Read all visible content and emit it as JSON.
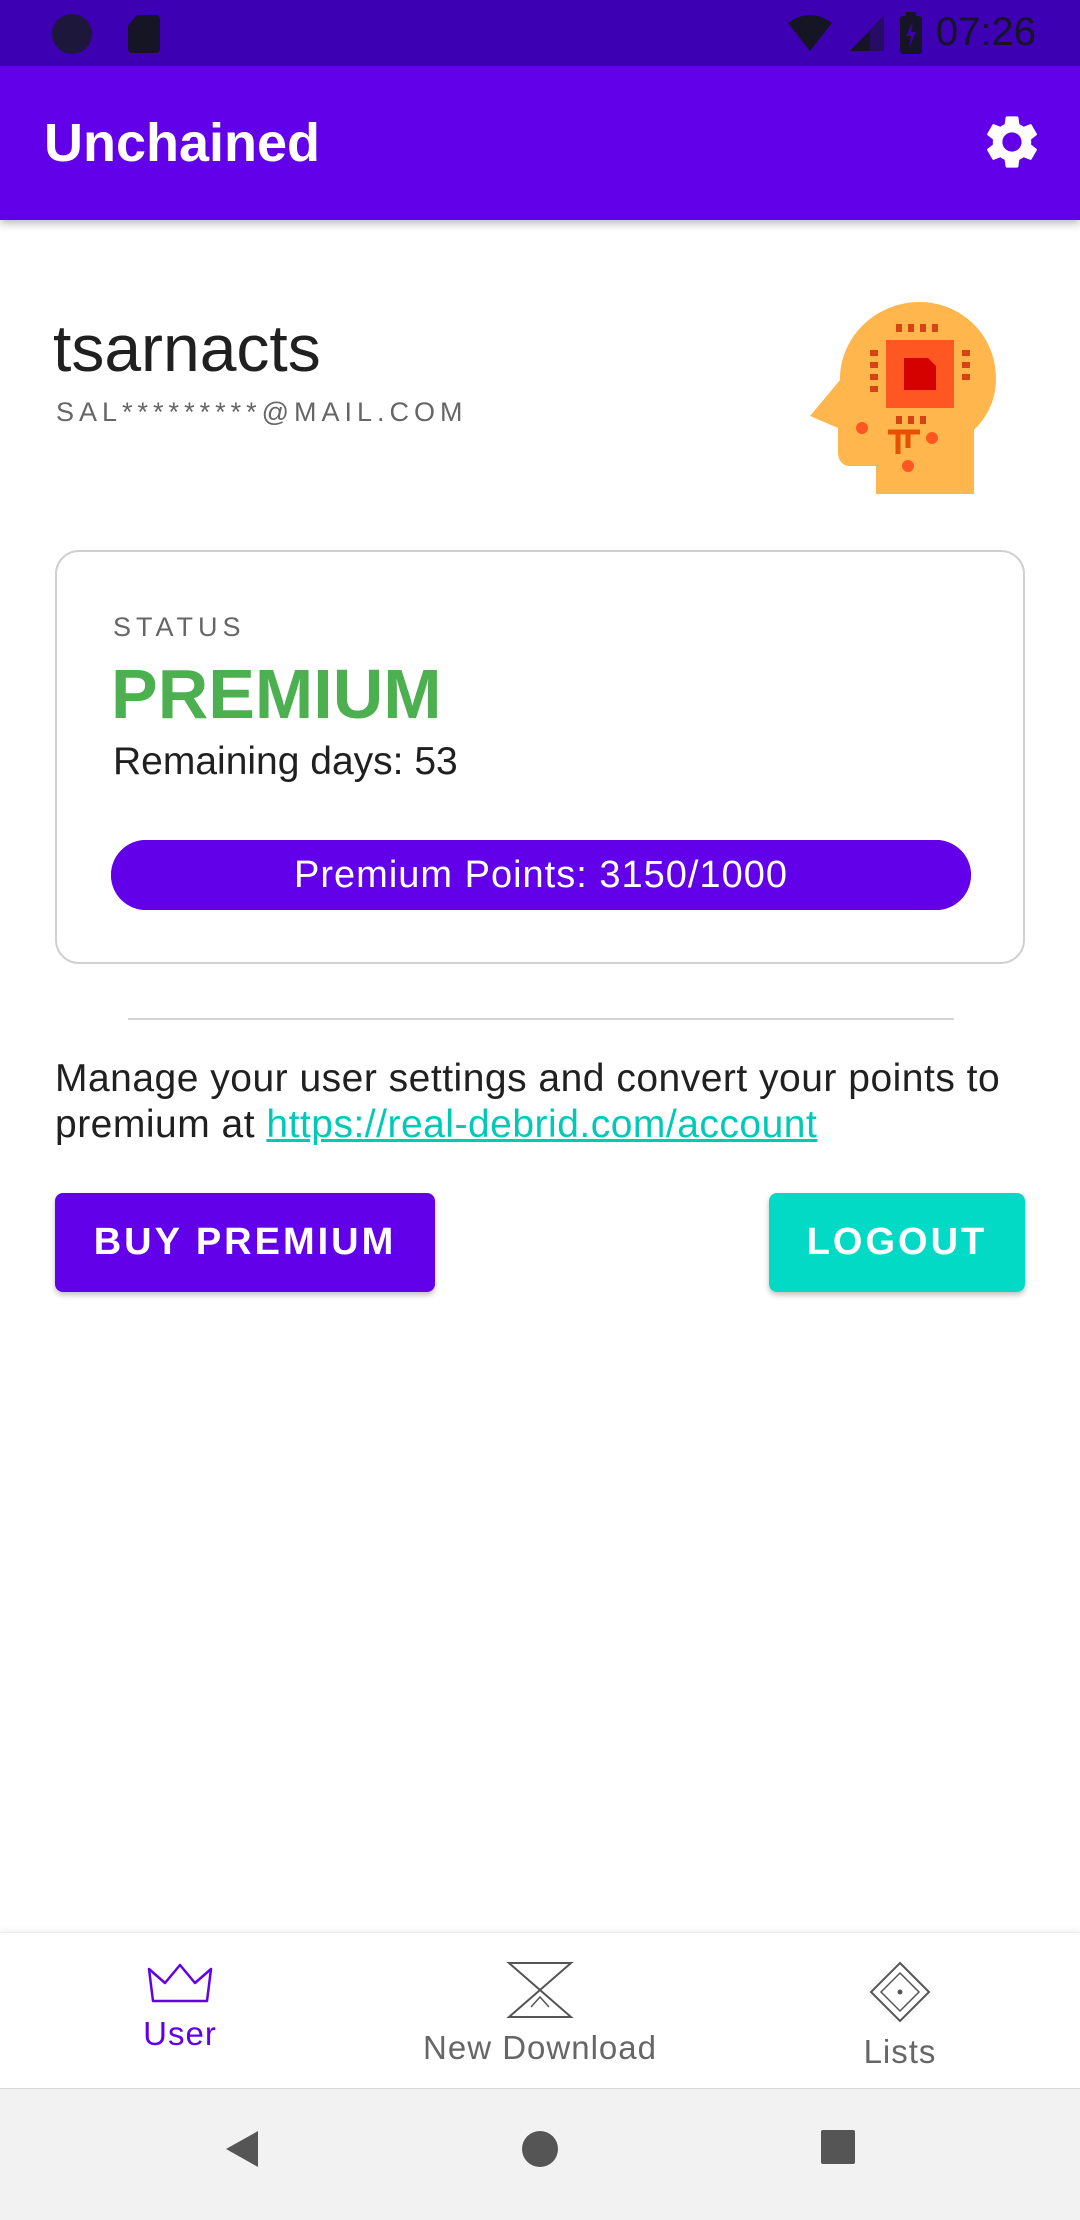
{
  "status_bar": {
    "time": "07:26"
  },
  "app_bar": {
    "title": "Unchained",
    "settings_icon": "gear-icon"
  },
  "user": {
    "username": "tsarnacts",
    "email": "SAL*********@MAIL.COM",
    "avatar_icon": "head-chip-icon"
  },
  "status_card": {
    "label": "STATUS",
    "value": "PREMIUM",
    "remaining_days_label": "Remaining days: ",
    "remaining_days_value": "53",
    "points_text": "Premium Points: 3150/1000",
    "points_fill_fraction": 1.0
  },
  "manage": {
    "text": "Manage your user settings and convert your points to premium at ",
    "link": "https://real-debrid.com/account"
  },
  "buttons": {
    "buy": "BUY PREMIUM",
    "logout": "LOGOUT"
  },
  "bottom_nav": {
    "items": [
      {
        "label": "User",
        "icon": "crown-icon",
        "active": true
      },
      {
        "label": "New Download",
        "icon": "hourglass-icon",
        "active": false
      },
      {
        "label": "Lists",
        "icon": "diamond-icon",
        "active": false
      }
    ]
  },
  "colors": {
    "primary": "#6200ea",
    "accent": "#03dac5",
    "premium": "#4caf50",
    "link": "#00c9b8"
  }
}
